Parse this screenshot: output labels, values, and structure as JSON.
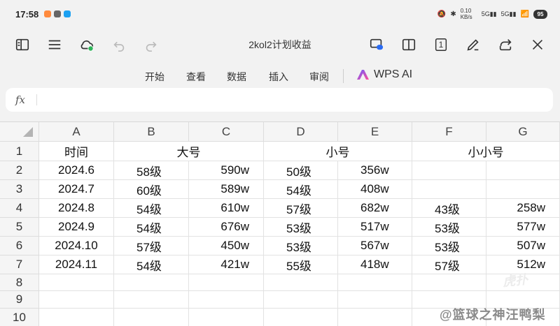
{
  "status_bar": {
    "time": "17:58",
    "network_speed": "0.10 KB/s",
    "battery": "95"
  },
  "toolbar": {
    "doc_title": "2kol2计划收益",
    "icons": [
      "outline-icon",
      "menu-icon",
      "cloud-sync-icon",
      "undo-icon",
      "redo-icon",
      "screen-cast-icon",
      "split-view-icon",
      "page-count-icon",
      "pen-icon",
      "share-icon",
      "close-icon"
    ],
    "page_count": "1"
  },
  "tabs": [
    {
      "label": "开始"
    },
    {
      "label": "查看"
    },
    {
      "label": "数据"
    },
    {
      "label": "插入"
    },
    {
      "label": "审阅"
    }
  ],
  "ai_label": "WPS AI",
  "formula_bar": {
    "fx_label": "fx",
    "value": ""
  },
  "columns": [
    "A",
    "B",
    "C",
    "D",
    "E",
    "F",
    "G"
  ],
  "rows": [
    "1",
    "2",
    "3",
    "4",
    "5",
    "6",
    "7",
    "8",
    "9",
    "10"
  ],
  "header_row": {
    "time": "时间",
    "big": "大号",
    "small": "小号",
    "tiny": "小小号"
  },
  "data_rows": [
    {
      "date": "2024.6",
      "b": "58级",
      "c": "590w",
      "d": "50级",
      "e": "356w",
      "f": "",
      "g": ""
    },
    {
      "date": "2024.7",
      "b": "60级",
      "c": "589w",
      "d": "54级",
      "e": "408w",
      "f": "",
      "g": ""
    },
    {
      "date": "2024.8",
      "b": "54级",
      "c": "610w",
      "d": "57级",
      "e": "682w",
      "f": "43级",
      "g": "258w"
    },
    {
      "date": "2024.9",
      "b": "54级",
      "c": "676w",
      "d": "53级",
      "e": "517w",
      "f": "53级",
      "g": "577w"
    },
    {
      "date": "2024.10",
      "b": "57级",
      "c": "450w",
      "d": "53级",
      "e": "567w",
      "f": "53级",
      "g": "507w"
    },
    {
      "date": "2024.11",
      "b": "54级",
      "c": "421w",
      "d": "55级",
      "e": "418w",
      "f": "57级",
      "g": "512w"
    }
  ],
  "watermark": "@篮球之神汪鸭梨",
  "logo_watermark": "虎扑",
  "colors": {
    "cloud_ok": "#2fb55a",
    "ai_gradient_start": "#6a5cff",
    "ai_gradient_end": "#ff4d9a"
  }
}
